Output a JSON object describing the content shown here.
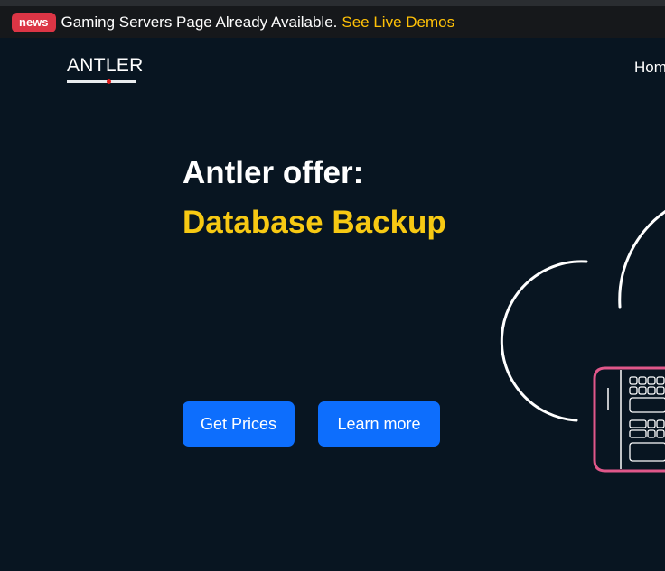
{
  "newsbar": {
    "badge": "news",
    "message": "Gaming Servers Page Already Available.",
    "link": "See Live Demos"
  },
  "header": {
    "logo": "ANTLER",
    "nav": [
      "Hom"
    ]
  },
  "hero": {
    "title": "Antler offer:",
    "subtitle": "Database Backup",
    "buttons": {
      "primary": "Get Prices",
      "secondary": "Learn more"
    }
  },
  "colors": {
    "background": "#081521",
    "accent_yellow": "#f7c913",
    "button_blue": "#0d6efd",
    "badge_red": "#dc3545",
    "illustration_pink": "#e0578a"
  },
  "icons": [
    "cloud-illustration",
    "keyboard-device-illustration"
  ]
}
